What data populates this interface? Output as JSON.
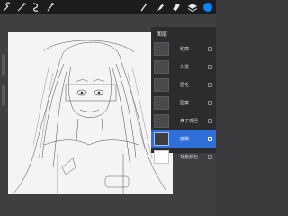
{
  "topbar": {
    "left_icons": [
      "wrench-icon",
      "magic-wand-icon",
      "selection-icon",
      "transform-icon"
    ],
    "right_icons": [
      "brush-icon",
      "smudge-icon",
      "eraser-icon",
      "layers-icon"
    ],
    "color_swatch": "#0a84ff"
  },
  "layers_panel": {
    "title": "图层",
    "layers": [
      {
        "name": "轮廓",
        "active": false
      },
      {
        "name": "头发",
        "active": false
      },
      {
        "name": "眉毛",
        "active": false
      },
      {
        "name": "图案",
        "active": false
      },
      {
        "name": "鼻子嘴巴",
        "active": false
      },
      {
        "name": "底稿",
        "active": true
      },
      {
        "name": "背景颜色",
        "active": false
      }
    ],
    "active_color": "#2f6fd9"
  }
}
